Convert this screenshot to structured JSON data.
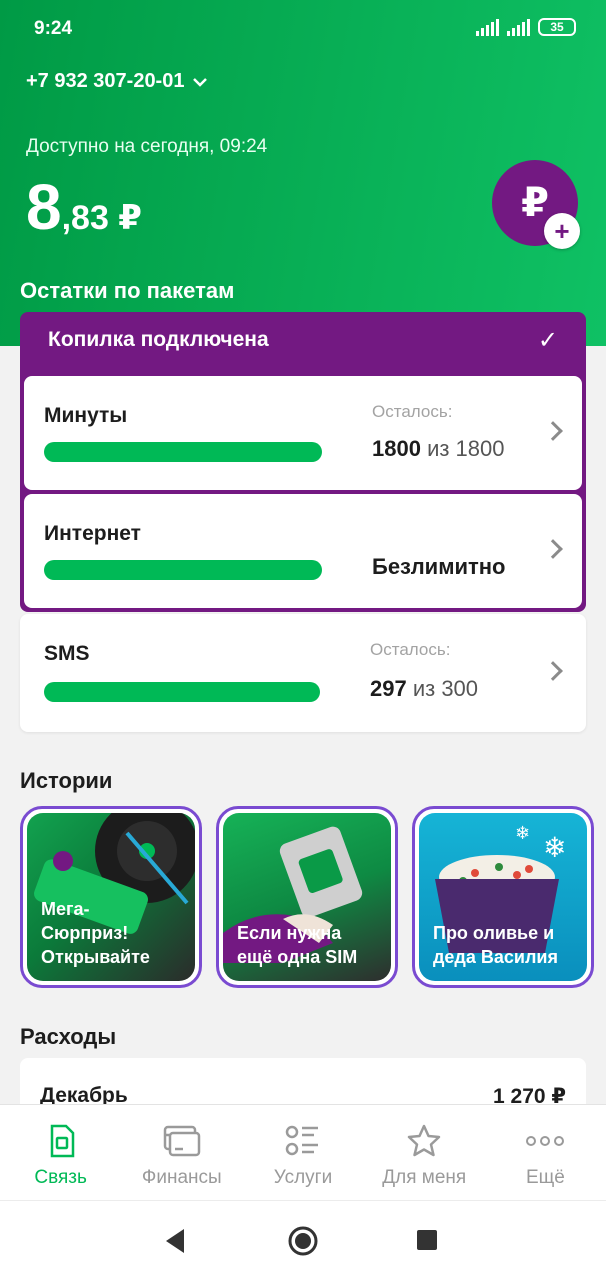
{
  "status": {
    "time": "9:24",
    "battery": "35"
  },
  "account": {
    "phone": "+7 932 307-20-01"
  },
  "balance": {
    "available_label": "Доступно на сегодня, 09:24",
    "integer": "8",
    "fraction": ",83 ₽",
    "topup_symbol": "₽",
    "topup_plus": "+"
  },
  "packages": {
    "title": "Остатки по пакетам",
    "piggy_label": "Копилка подключена",
    "check": "✓",
    "items": [
      {
        "name": "Минуты",
        "caption": "Осталось:",
        "left": "1800",
        "of": " из 1800",
        "fill": 1.0
      },
      {
        "name": "Интернет",
        "caption": "",
        "unlimited": "Безлимитно",
        "fill": 1.0
      },
      {
        "name": "SMS",
        "caption": "Осталось:",
        "left": "297",
        "of": " из 300",
        "fill": 0.99
      }
    ]
  },
  "stories": {
    "title": "Истории",
    "items": [
      {
        "text": "Мега-\nСюрприз!\nОткрывайте"
      },
      {
        "text": "Если нужна\nещё одна SIM"
      },
      {
        "text": "Про оливье и\nдеда Василия"
      }
    ]
  },
  "expenses": {
    "title": "Расходы",
    "month": "Декабрь",
    "sum": "1 270 ₽"
  },
  "tabs": [
    {
      "label": "Связь",
      "icon": "sim-icon",
      "active": true
    },
    {
      "label": "Финансы",
      "icon": "card-icon"
    },
    {
      "label": "Услуги",
      "icon": "list-icon"
    },
    {
      "label": "Для меня",
      "icon": "star-icon"
    },
    {
      "label": "Ещё",
      "icon": "more-icon"
    }
  ],
  "colors": {
    "brand_green": "#00b956",
    "brand_purple": "#731982"
  }
}
